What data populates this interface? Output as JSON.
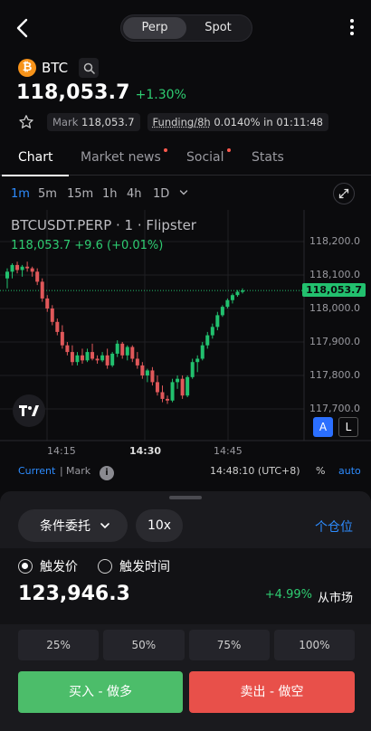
{
  "header": {
    "segments": [
      "Perp",
      "Spot"
    ],
    "active_segment": "Perp"
  },
  "symbol": {
    "name": "BTC",
    "logo_glyph": "₿"
  },
  "price": {
    "last": "118,053.7",
    "change_pct": "+1.30%"
  },
  "info": {
    "mark_label": "Mark",
    "mark_value": "118,053.7",
    "funding_label": "Funding/8h",
    "funding_value": "0.0140%",
    "funding_in": "in",
    "funding_countdown": "01:11:48"
  },
  "tabs": [
    {
      "label": "Chart",
      "active": true,
      "dot": false
    },
    {
      "label": "Market news",
      "active": false,
      "dot": true
    },
    {
      "label": "Social",
      "active": false,
      "dot": true
    },
    {
      "label": "Stats",
      "active": false,
      "dot": false
    }
  ],
  "timeframes": [
    "1m",
    "5m",
    "15m",
    "1h",
    "4h",
    "1D"
  ],
  "active_timeframe": "1m",
  "chart_overlay": {
    "title": "BTCUSDT.PERP · 1 · Flipster",
    "last_line": "118,053.7  +9.6 (+0.01%)",
    "price_tag": "118,053.7",
    "btn_a": "A",
    "btn_l": "L"
  },
  "chart_data": {
    "type": "candlestick",
    "y_ticks": [
      "118,200.0",
      "118,100.0",
      "118,000.0",
      "117,900.0",
      "117,800.0",
      "117,700.0"
    ],
    "x_ticks": [
      "14:15",
      "14:30",
      "14:45"
    ],
    "ylim": [
      117700,
      118250
    ],
    "current_price": 118053.7,
    "candles": [
      {
        "o": 118090,
        "h": 118120,
        "l": 118060,
        "c": 118110
      },
      {
        "o": 118110,
        "h": 118135,
        "l": 118090,
        "c": 118130
      },
      {
        "o": 118130,
        "h": 118140,
        "l": 118105,
        "c": 118115
      },
      {
        "o": 118115,
        "h": 118130,
        "l": 118095,
        "c": 118125
      },
      {
        "o": 118125,
        "h": 118140,
        "l": 118110,
        "c": 118120
      },
      {
        "o": 118120,
        "h": 118125,
        "l": 118095,
        "c": 118110
      },
      {
        "o": 118110,
        "h": 118120,
        "l": 118070,
        "c": 118080
      },
      {
        "o": 118080,
        "h": 118090,
        "l": 118020,
        "c": 118030
      },
      {
        "o": 118030,
        "h": 118040,
        "l": 117990,
        "c": 118000
      },
      {
        "o": 118000,
        "h": 118010,
        "l": 117950,
        "c": 117960
      },
      {
        "o": 117960,
        "h": 117970,
        "l": 117920,
        "c": 117930
      },
      {
        "o": 117930,
        "h": 117950,
        "l": 117880,
        "c": 117890
      },
      {
        "o": 117890,
        "h": 117900,
        "l": 117860,
        "c": 117870
      },
      {
        "o": 117870,
        "h": 117890,
        "l": 117830,
        "c": 117840
      },
      {
        "o": 117840,
        "h": 117870,
        "l": 117830,
        "c": 117860
      },
      {
        "o": 117860,
        "h": 117880,
        "l": 117835,
        "c": 117845
      },
      {
        "o": 117845,
        "h": 117880,
        "l": 117840,
        "c": 117870
      },
      {
        "o": 117870,
        "h": 117895,
        "l": 117845,
        "c": 117850
      },
      {
        "o": 117850,
        "h": 117860,
        "l": 117835,
        "c": 117845
      },
      {
        "o": 117845,
        "h": 117870,
        "l": 117840,
        "c": 117860
      },
      {
        "o": 117860,
        "h": 117880,
        "l": 117820,
        "c": 117830
      },
      {
        "o": 117830,
        "h": 117870,
        "l": 117825,
        "c": 117865
      },
      {
        "o": 117865,
        "h": 117905,
        "l": 117855,
        "c": 117895
      },
      {
        "o": 117895,
        "h": 117900,
        "l": 117850,
        "c": 117860
      },
      {
        "o": 117860,
        "h": 117890,
        "l": 117845,
        "c": 117885
      },
      {
        "o": 117885,
        "h": 117890,
        "l": 117840,
        "c": 117850
      },
      {
        "o": 117850,
        "h": 117870,
        "l": 117820,
        "c": 117830
      },
      {
        "o": 117830,
        "h": 117840,
        "l": 117790,
        "c": 117800
      },
      {
        "o": 117800,
        "h": 117820,
        "l": 117780,
        "c": 117815
      },
      {
        "o": 117815,
        "h": 117825,
        "l": 117770,
        "c": 117780
      },
      {
        "o": 117780,
        "h": 117800,
        "l": 117740,
        "c": 117750
      },
      {
        "o": 117750,
        "h": 117770,
        "l": 117720,
        "c": 117730
      },
      {
        "o": 117730,
        "h": 117740,
        "l": 117715,
        "c": 117725
      },
      {
        "o": 117725,
        "h": 117790,
        "l": 117720,
        "c": 117780
      },
      {
        "o": 117780,
        "h": 117800,
        "l": 117760,
        "c": 117790
      },
      {
        "o": 117790,
        "h": 117800,
        "l": 117730,
        "c": 117740
      },
      {
        "o": 117740,
        "h": 117800,
        "l": 117735,
        "c": 117795
      },
      {
        "o": 117795,
        "h": 117850,
        "l": 117790,
        "c": 117840
      },
      {
        "o": 117840,
        "h": 117860,
        "l": 117810,
        "c": 117850
      },
      {
        "o": 117850,
        "h": 117900,
        "l": 117845,
        "c": 117890
      },
      {
        "o": 117890,
        "h": 117930,
        "l": 117880,
        "c": 117920
      },
      {
        "o": 117920,
        "h": 117955,
        "l": 117910,
        "c": 117945
      },
      {
        "o": 117945,
        "h": 117990,
        "l": 117935,
        "c": 117980
      },
      {
        "o": 117980,
        "h": 118010,
        "l": 117975,
        "c": 118005
      },
      {
        "o": 118005,
        "h": 118030,
        "l": 118000,
        "c": 118025
      },
      {
        "o": 118025,
        "h": 118045,
        "l": 118015,
        "c": 118040
      },
      {
        "o": 118040,
        "h": 118055,
        "l": 118035,
        "c": 118050
      },
      {
        "o": 118050,
        "h": 118060,
        "l": 118045,
        "c": 118054
      }
    ],
    "colors": {
      "up": "#22c06e",
      "down": "#e0585a"
    }
  },
  "current_mark": {
    "current": "Current",
    "sep": "|",
    "mark": "Mark",
    "info_glyph": "i",
    "time": "14:48:10 (UTC+8)",
    "pct": "%",
    "auto": "auto"
  },
  "order": {
    "type_label": "条件委托",
    "leverage": "10x",
    "position_link": "个仓位",
    "trigger_price_label": "触发价",
    "trigger_time_label": "触发时间",
    "trigger_price_value": "123,946.3",
    "trigger_diff": "+4.99%",
    "trigger_from": "从市场",
    "percent_options": [
      "25%",
      "50%",
      "75%",
      "100%"
    ],
    "buy_label": "买入 - 做多",
    "sell_label": "卖出 - 做空"
  }
}
